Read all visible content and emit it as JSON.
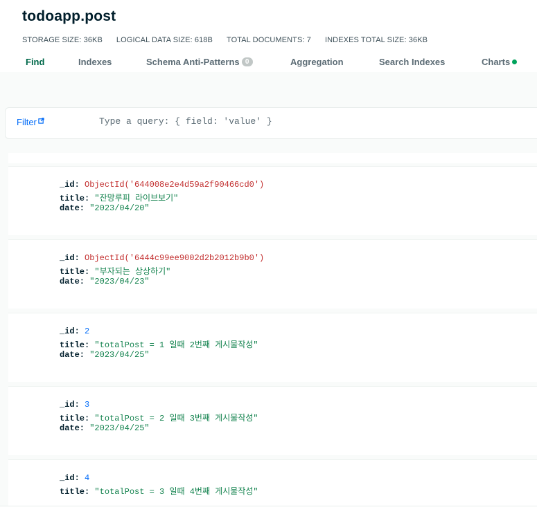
{
  "collection": {
    "title": "todoapp.post"
  },
  "stats": [
    {
      "label": "STORAGE SIZE: 36KB"
    },
    {
      "label": "LOGICAL DATA SIZE: 618B"
    },
    {
      "label": "TOTAL DOCUMENTS: 7"
    },
    {
      "label": "INDEXES TOTAL SIZE: 36KB"
    }
  ],
  "tabs": {
    "find": "Find",
    "indexes": "Indexes",
    "schema": "Schema Anti-Patterns",
    "schema_badge": "0",
    "aggregation": "Aggregation",
    "search_indexes": "Search Indexes",
    "charts": "Charts"
  },
  "filter": {
    "label": "Filter",
    "placeholder": "Type a query: { field: 'value' }",
    "value": ""
  },
  "documents": [
    {
      "id_key": "_id:",
      "id_value": "ObjectId('644008e2e4d59a2f90466cd0')",
      "title_key": "title:",
      "title_value": "\"잔망루피 라이브보기\"",
      "date_key": "date:",
      "date_value": "\"2023/04/20\""
    },
    {
      "id_key": "_id:",
      "id_value": "ObjectId('6444c99ee9002d2b2012b9b0')",
      "title_key": "title:",
      "title_value": "\"부자되는 상상하기\"",
      "date_key": "date:",
      "date_value": "\"2023/04/23\""
    },
    {
      "id_key": "_id:",
      "id_value": "2",
      "title_key": "title:",
      "title_value": "\"totalPost = 1 일때 2번째 게시물작성\"",
      "date_key": "date:",
      "date_value": "\"2023/04/25\""
    },
    {
      "id_key": "_id:",
      "id_value": "3",
      "title_key": "title:",
      "title_value": "\"totalPost = 2 일때 3번째 게시물작성\"",
      "date_key": "date:",
      "date_value": "\"2023/04/25\""
    },
    {
      "id_key": "_id:",
      "id_value": "4",
      "title_key": "title:",
      "title_value": "\"totalPost = 3 일때 4번째 게시물작성\""
    }
  ],
  "colors": {
    "active_tab": "#00684a",
    "charts_dot": "#00a35c",
    "object_id": "#c22d2d",
    "string_value": "#12824d",
    "number_value": "#016bf8",
    "filter_link": "#016bf8"
  },
  "icons": {
    "filter_link": "external-link-icon",
    "charts_status": "status-dot-icon"
  }
}
